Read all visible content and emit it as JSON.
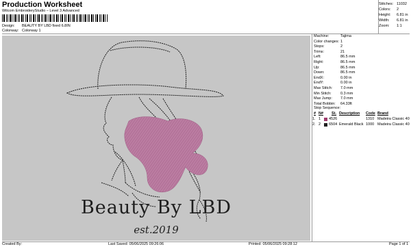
{
  "header": {
    "title": "Production Worksheet",
    "subtitle": "Wilcom EmbroideryStudio – Level 3 Advanced",
    "design_label": "Design:",
    "design_value": "BEAUTY BY LBD fixed 6.8IN",
    "colorway_label": "Colorway:",
    "colorway_value": "Colorway 1"
  },
  "stats": [
    {
      "label": "Stitches:",
      "value": "11032"
    },
    {
      "label": "Colors:",
      "value": "2"
    },
    {
      "label": "Height:",
      "value": "6.81 in"
    },
    {
      "label": "Width:",
      "value": "6.81 in"
    },
    {
      "label": "Zoom:",
      "value": "1:1"
    }
  ],
  "design": {
    "brand_text": "Beauty By LBD",
    "est_text": "est.2019",
    "canvas_color": "#c6c6c6",
    "fill_color": "#b4749a"
  },
  "machine": [
    {
      "label": "Machine:",
      "value": "Tajima"
    },
    {
      "label": "Color changes:",
      "value": "1"
    },
    {
      "label": "Stops:",
      "value": "2"
    },
    {
      "label": "Trims:",
      "value": "21"
    },
    {
      "label": "Left:",
      "value": "86.5 mm"
    },
    {
      "label": "Right:",
      "value": "86.5 mm"
    },
    {
      "label": "Up:",
      "value": "86.5 mm"
    },
    {
      "label": "Down:",
      "value": "86.5 mm"
    },
    {
      "label": "EndX:",
      "value": "0.00 in"
    },
    {
      "label": "EndY:",
      "value": "0.00 in"
    },
    {
      "label": "Max Stitch:",
      "value": "7.0 mm"
    },
    {
      "label": "Min Stitch:",
      "value": "0.3 mm"
    },
    {
      "label": "Max Jump:",
      "value": "7.0 mm"
    },
    {
      "label": "Total Bobbin:",
      "value": "64.33ft"
    }
  ],
  "stop_sequence": {
    "label": "Stop Sequence:",
    "headers": {
      "num": "#",
      "n": "N#",
      "st": "St.",
      "description": "Description",
      "code": "Code",
      "brand": "Brand"
    },
    "rows": [
      {
        "num": "1.",
        "n": "1",
        "code_num": "4526",
        "description": "",
        "stitches": "1310",
        "brand": "Madeira Classic 40",
        "swatch": "#9e3b6c"
      },
      {
        "num": "2.",
        "n": "2",
        "code_num": "6504",
        "description": "Emerald Black",
        "stitches": "1000",
        "brand": "Madeira Classic 40",
        "swatch": "#202020"
      }
    ]
  },
  "footer": {
    "created_by": "Created By:",
    "last_saved": "Last Saved: 05/06/2025 09:26:06",
    "printed": "Printed: 05/06/2025 09:28:12",
    "page": "Page 1 of 1"
  }
}
